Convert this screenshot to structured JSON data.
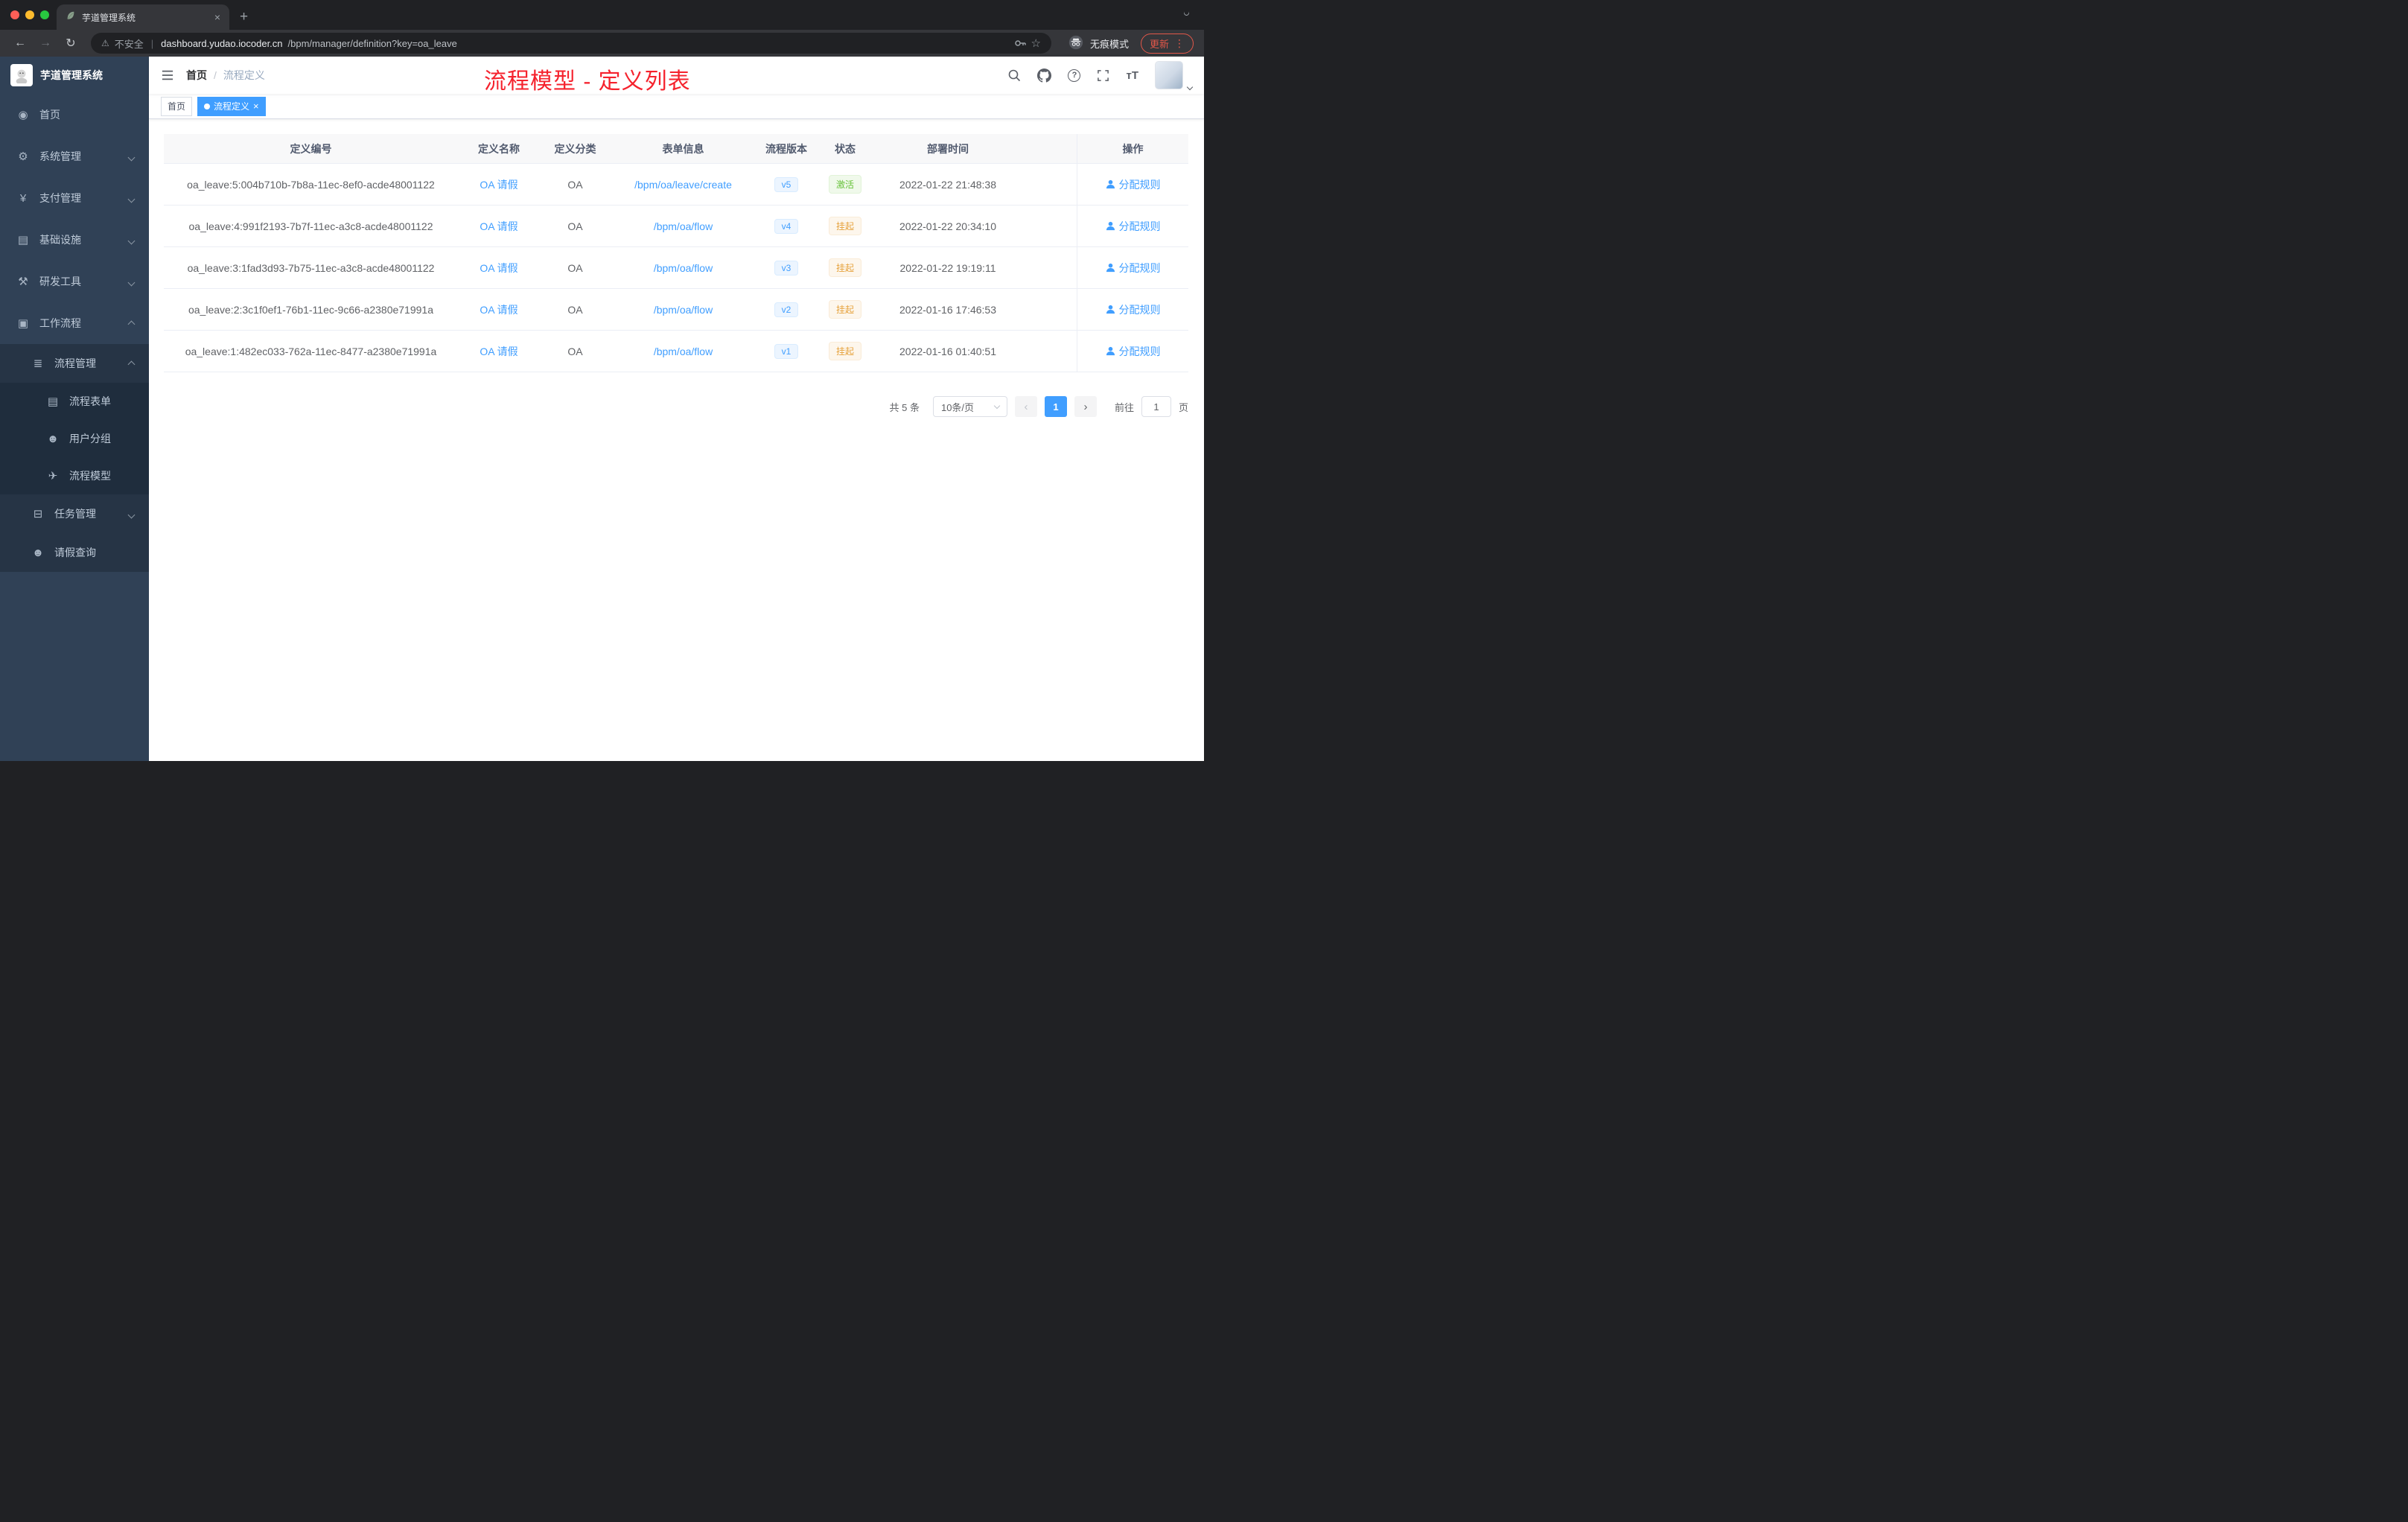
{
  "browser": {
    "tab_title": "芋道管理系统",
    "security_label": "不安全",
    "url_host": "dashboard.yudao.iocoder.cn",
    "url_path": "/bpm/manager/definition?key=oa_leave",
    "incognito_label": "无痕模式",
    "update_label": "更新"
  },
  "sidebar": {
    "logo_title": "芋道管理系统",
    "items": [
      {
        "label": "首页"
      },
      {
        "label": "系统管理"
      },
      {
        "label": "支付管理"
      },
      {
        "label": "基础设施"
      },
      {
        "label": "研发工具"
      },
      {
        "label": "工作流程"
      },
      {
        "label": "流程管理"
      },
      {
        "label": "流程表单"
      },
      {
        "label": "用户分组"
      },
      {
        "label": "流程模型"
      },
      {
        "label": "任务管理"
      },
      {
        "label": "请假查询"
      }
    ]
  },
  "header": {
    "breadcrumb_home": "首页",
    "breadcrumb_sep": "/",
    "breadcrumb_current": "流程定义",
    "annotation": "流程模型 - 定义列表"
  },
  "tags": {
    "home": "首页",
    "active": "流程定义"
  },
  "table": {
    "columns": [
      "定义编号",
      "定义名称",
      "定义分类",
      "表单信息",
      "流程版本",
      "状态",
      "部署时间",
      "操作"
    ],
    "rows": [
      {
        "id": "oa_leave:5:004b710b-7b8a-11ec-8ef0-acde48001122",
        "name": "OA 请假",
        "category": "OA",
        "form": "/bpm/oa/leave/create",
        "version": "v5",
        "status": "激活",
        "status_type": "active",
        "time": "2022-01-22 21:48:38",
        "action": "分配规则"
      },
      {
        "id": "oa_leave:4:991f2193-7b7f-11ec-a3c8-acde48001122",
        "name": "OA 请假",
        "category": "OA",
        "form": "/bpm/oa/flow",
        "version": "v4",
        "status": "挂起",
        "status_type": "suspended",
        "time": "2022-01-22 20:34:10",
        "action": "分配规则"
      },
      {
        "id": "oa_leave:3:1fad3d93-7b75-11ec-a3c8-acde48001122",
        "name": "OA 请假",
        "category": "OA",
        "form": "/bpm/oa/flow",
        "version": "v3",
        "status": "挂起",
        "status_type": "suspended",
        "time": "2022-01-22 19:19:11",
        "action": "分配规则"
      },
      {
        "id": "oa_leave:2:3c1f0ef1-76b1-11ec-9c66-a2380e71991a",
        "name": "OA 请假",
        "category": "OA",
        "form": "/bpm/oa/flow",
        "version": "v2",
        "status": "挂起",
        "status_type": "suspended",
        "time": "2022-01-16 17:46:53",
        "action": "分配规则"
      },
      {
        "id": "oa_leave:1:482ec033-762a-11ec-8477-a2380e71991a",
        "name": "OA 请假",
        "category": "OA",
        "form": "/bpm/oa/flow",
        "version": "v1",
        "status": "挂起",
        "status_type": "suspended",
        "time": "2022-01-16 01:40:51",
        "action": "分配规则"
      }
    ]
  },
  "pagination": {
    "total": "共 5 条",
    "page_size": "10条/页",
    "current_page": "1",
    "goto_label": "前往",
    "goto_value": "1",
    "page_unit": "页"
  },
  "icons": {
    "home": "◉",
    "gear": "⚙",
    "yen": "¥",
    "infra": "▤",
    "tools": "⚒",
    "workflow": "▣",
    "process": "≣",
    "form": "▤",
    "usergroup": "☻",
    "model": "✈",
    "task": "⊟",
    "person": "☻",
    "back": "←",
    "forward": "→",
    "reload": "↻",
    "warning": "⚠",
    "divider": "|",
    "star": "☆",
    "close": "×",
    "plus": "+",
    "dots": "⋮",
    "prev": "‹",
    "next": "›"
  },
  "colors": {
    "accent": "#409eff",
    "annotation_red": "#f5222d",
    "sidebar_bg": "#304156",
    "status_active_text": "#67c23a",
    "status_suspended_text": "#e6a23c"
  }
}
